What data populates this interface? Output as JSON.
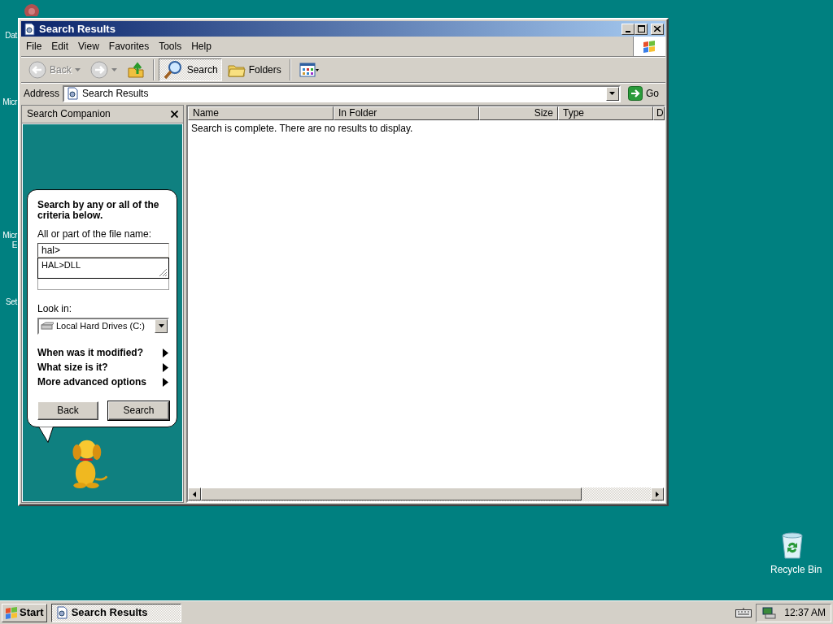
{
  "desktop": {
    "labels": [
      {
        "lines": [
          "Dat"
        ]
      },
      {
        "lines": [
          "Micr"
        ]
      },
      {
        "lines": [
          "Micr",
          "E"
        ]
      },
      {
        "lines": [
          "Set"
        ]
      }
    ],
    "recycle_bin": {
      "label": "Recycle Bin"
    }
  },
  "window": {
    "title": "Search Results",
    "menu": [
      "File",
      "Edit",
      "View",
      "Favorites",
      "Tools",
      "Help"
    ],
    "toolbar": [
      {
        "kind": "back",
        "label": "Back",
        "disabled": true
      },
      {
        "kind": "forward",
        "disabled": true
      },
      {
        "kind": "up",
        "disabled": false
      },
      {
        "kind": "separator"
      },
      {
        "kind": "search",
        "label": "Search",
        "selected": true
      },
      {
        "kind": "folders",
        "label": "Folders",
        "selected": false
      },
      {
        "kind": "separator"
      },
      {
        "kind": "views"
      }
    ],
    "address": {
      "label": "Address",
      "value": "Search Results",
      "go": "Go"
    },
    "search_companion": {
      "title": "Search Companion",
      "heading": "Search by any or all of the criteria below.",
      "name_label": "All or part of the file name:",
      "name_value": "hal>",
      "suggestions": [
        "HAL>DLL"
      ],
      "look_in_label": "Look in:",
      "look_in_value": "Local Hard Drives (C:)",
      "options": [
        {
          "label": "When was it modified?",
          "expanded": false
        },
        {
          "label": "What size is it?",
          "expanded": false
        },
        {
          "label": "More advanced options",
          "expanded": false
        }
      ],
      "buttons": [
        "Back",
        "Search"
      ]
    },
    "results": {
      "columns": [
        "Name",
        "In Folder",
        "Size",
        "Type",
        "D"
      ],
      "message": "Search is complete. There are no results to display."
    }
  },
  "taskbar": {
    "start": "Start",
    "tasks": [
      {
        "label": "Search Results",
        "selected": true
      }
    ],
    "clock": "12:37 AM"
  }
}
